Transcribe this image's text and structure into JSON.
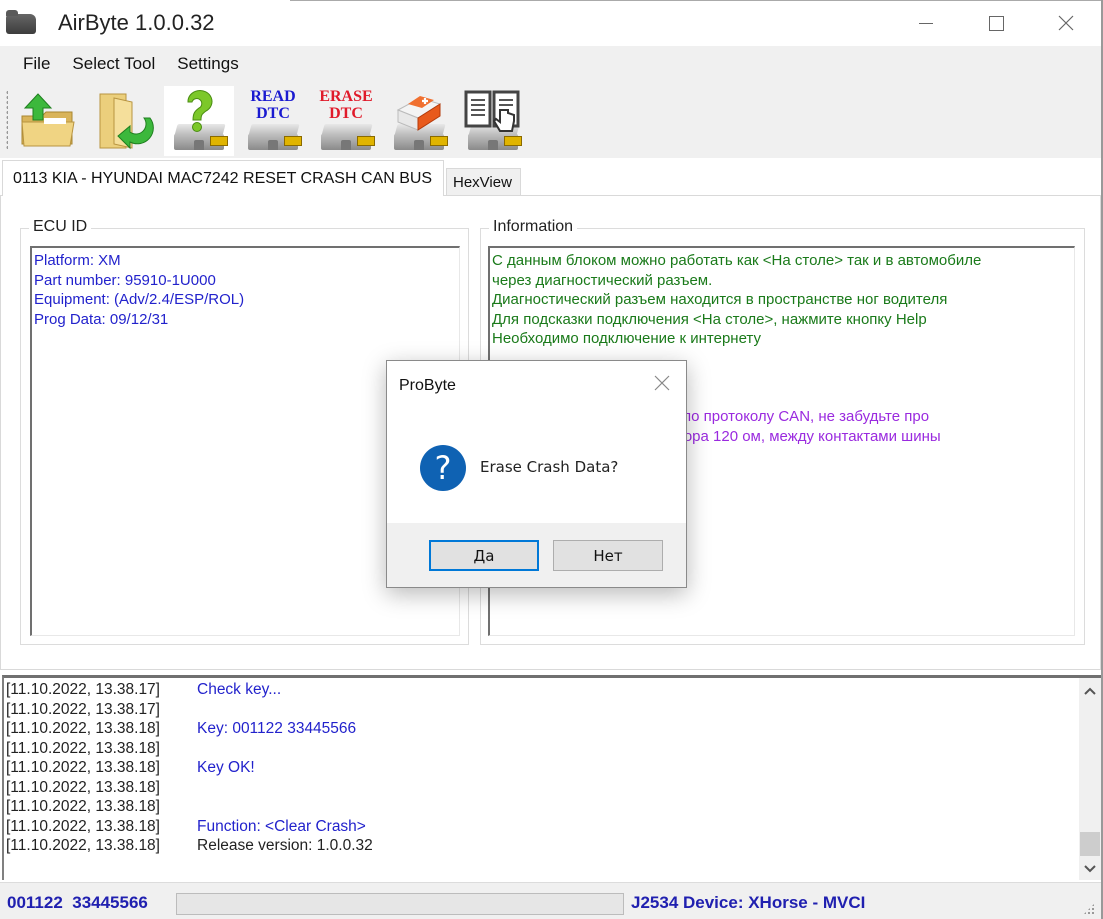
{
  "window": {
    "title": "AirByte  1.0.0.32",
    "controls": {
      "minimize": "minimize",
      "maximize": "maximize",
      "close": "close"
    }
  },
  "menu": {
    "items": [
      {
        "label": "File"
      },
      {
        "label": "Select Tool"
      },
      {
        "label": "Settings"
      }
    ]
  },
  "toolbar": {
    "buttons": [
      {
        "name": "open-file",
        "icon": "folder-upload-icon"
      },
      {
        "name": "save-file",
        "icon": "folder-arrow-icon"
      },
      {
        "name": "identify-ecu",
        "icon": "question-ecu-icon"
      },
      {
        "name": "read-dtc",
        "icon": "read-dtc-icon",
        "line1": "READ",
        "line2": "DTC"
      },
      {
        "name": "erase-dtc",
        "icon": "erase-dtc-icon",
        "line1": "ERASE",
        "line2": "DTC"
      },
      {
        "name": "erase-crash",
        "icon": "eraser-ecu-icon"
      },
      {
        "name": "help-manual",
        "icon": "book-hand-icon"
      }
    ]
  },
  "tabs": [
    {
      "label": "0113 KIA - HYUNDAI MAC7242 RESET CRASH CAN BUS",
      "active": true
    },
    {
      "label": "HexView",
      "active": false
    }
  ],
  "ecu_id": {
    "label": "ECU ID",
    "lines": [
      "Platform: XM",
      "Part number: 95910-1U000",
      "Equipment: (Adv/2.4/ESP/ROL)",
      "Prog Data: 09/12/31"
    ]
  },
  "information": {
    "label": "Information",
    "green_lines": [
      "С данным блоком можно работать как <На столе> так и в автомобиле",
      "через диагностический разъем.",
      "Диагностический разъем находится в пространстве ног водителя",
      "Для подсказки подключения <На столе>, нажмите кнопку Help",
      "Необходимо подключение к интернету"
    ],
    "purple_lines": [
      "оле> по протоколу CAN, не забудьте про",
      "резистора 120 ом, между контактами шины"
    ]
  },
  "log": {
    "rows": [
      {
        "ts": "[11.10.2022, 13.38.17]",
        "msg": "Check key...",
        "style": "blue"
      },
      {
        "ts": "[11.10.2022, 13.38.17]",
        "msg": "",
        "style": "blue"
      },
      {
        "ts": "[11.10.2022, 13.38.18]",
        "msg": "Key: 001122  33445566",
        "style": "blue"
      },
      {
        "ts": "[11.10.2022, 13.38.18]",
        "msg": "",
        "style": "blue"
      },
      {
        "ts": "[11.10.2022, 13.38.18]",
        "msg": "Key OK!",
        "style": "blue"
      },
      {
        "ts": "[11.10.2022, 13.38.18]",
        "msg": "",
        "style": "blue"
      },
      {
        "ts": "[11.10.2022, 13.38.18]",
        "msg": "",
        "style": "blue"
      },
      {
        "ts": "[11.10.2022, 13.38.18]",
        "msg": "Function: <Clear Crash>",
        "style": "blue"
      },
      {
        "ts": "[11.10.2022, 13.38.18]",
        "msg": "Release version: 1.0.0.32",
        "style": "dark"
      }
    ]
  },
  "statusbar": {
    "key": "001122  33445566",
    "progress_percent": 0,
    "device": "J2534 Device: XHorse - MVCI"
  },
  "dialog": {
    "title": "ProByte",
    "icon": "question-icon",
    "message": "Erase Crash Data?",
    "yes_label": "Да",
    "no_label": "Нет"
  },
  "colors": {
    "ecu_text": "#2222cc",
    "info_green": "#1a7a1a",
    "info_purple": "#9a2adf",
    "status_blue": "#2020b0",
    "dialog_icon": "#0f62b3",
    "default_button_border": "#0078d7"
  }
}
